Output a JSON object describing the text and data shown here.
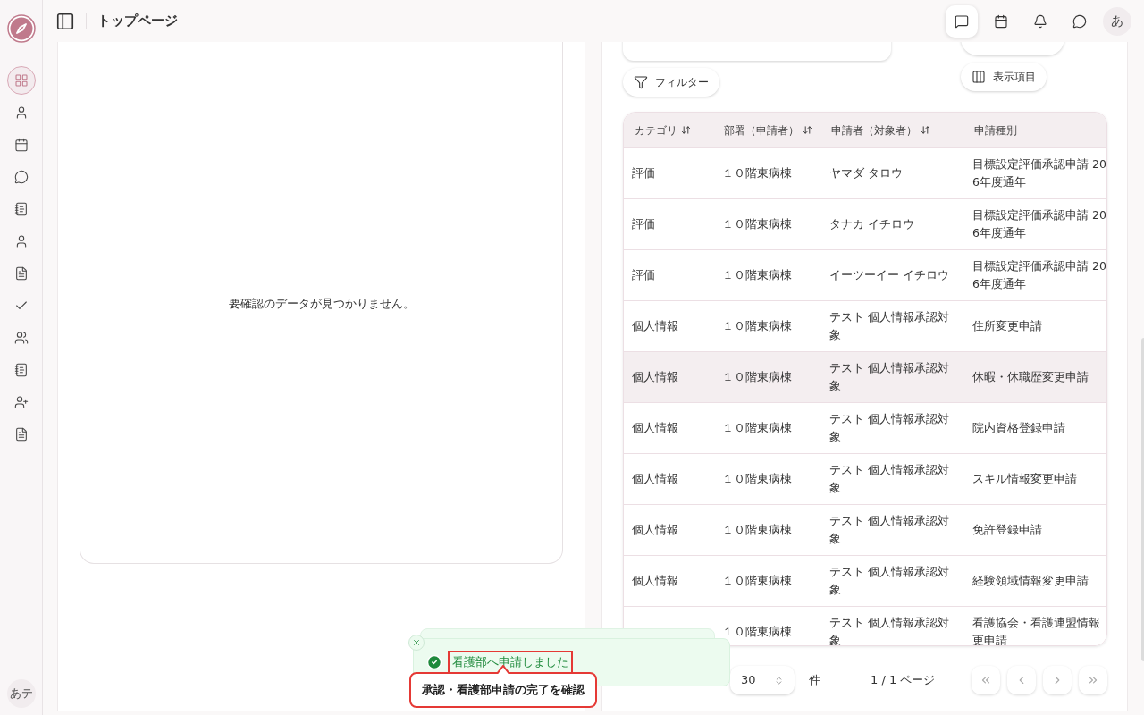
{
  "sidebar": {
    "items": [
      {
        "selected": true
      },
      {
        "selected": false
      },
      {
        "selected": false
      },
      {
        "selected": false
      },
      {
        "selected": false
      },
      {
        "selected": false
      },
      {
        "selected": false
      },
      {
        "selected": false
      },
      {
        "selected": false
      },
      {
        "selected": false
      },
      {
        "selected": false
      },
      {
        "selected": false
      }
    ],
    "avatar": "あテ"
  },
  "header": {
    "title": "トップページ",
    "icons": [
      {
        "selected": true
      },
      {
        "selected": false
      },
      {
        "selected": false
      },
      {
        "selected": false
      }
    ],
    "avatar": "あ"
  },
  "left_panel": {
    "empty_message": "要確認のデータが見つかりません。"
  },
  "right_panel": {
    "filter_button": "フィルター",
    "columns_button": "表示項目",
    "table": {
      "columns": [
        {
          "label": "カテゴリ",
          "sortable": true
        },
        {
          "label": "部署（申請者）",
          "sortable": true
        },
        {
          "label": "申請者（対象者）",
          "sortable": true
        },
        {
          "label": "申請種別",
          "sortable": false
        }
      ],
      "rows": [
        {
          "selected": false,
          "cells": [
            [
              "評価"
            ],
            [
              "１０階東病棟"
            ],
            [
              "ヤマダ タロウ"
            ],
            [
              "目標設定評価承認申請 20",
              "6年度通年"
            ]
          ]
        },
        {
          "selected": false,
          "cells": [
            [
              "評価"
            ],
            [
              "１０階東病棟"
            ],
            [
              "タナカ イチロウ"
            ],
            [
              "目標設定評価承認申請 20",
              "6年度通年"
            ]
          ]
        },
        {
          "selected": false,
          "cells": [
            [
              "評価"
            ],
            [
              "１０階東病棟"
            ],
            [
              "イーツーイー イチロウ"
            ],
            [
              "目標設定評価承認申請 20",
              "6年度通年"
            ]
          ]
        },
        {
          "selected": false,
          "cells": [
            [
              "個人情報"
            ],
            [
              "１０階東病棟"
            ],
            [
              "テスト 個人情報承認対",
              "象"
            ],
            [
              "住所変更申請"
            ]
          ]
        },
        {
          "selected": true,
          "cells": [
            [
              "個人情報"
            ],
            [
              "１０階東病棟"
            ],
            [
              "テスト 個人情報承認対",
              "象"
            ],
            [
              "休暇・休職歴変更申請"
            ]
          ]
        },
        {
          "selected": false,
          "cells": [
            [
              "個人情報"
            ],
            [
              "１０階東病棟"
            ],
            [
              "テスト 個人情報承認対",
              "象"
            ],
            [
              "院内資格登録申請"
            ]
          ]
        },
        {
          "selected": false,
          "cells": [
            [
              "個人情報"
            ],
            [
              "１０階東病棟"
            ],
            [
              "テスト 個人情報承認対",
              "象"
            ],
            [
              "スキル情報変更申請"
            ]
          ]
        },
        {
          "selected": false,
          "cells": [
            [
              "個人情報"
            ],
            [
              "１０階東病棟"
            ],
            [
              "テスト 個人情報承認対",
              "象"
            ],
            [
              "免許登録申請"
            ]
          ]
        },
        {
          "selected": false,
          "cells": [
            [
              "個人情報"
            ],
            [
              "１０階東病棟"
            ],
            [
              "テスト 個人情報承認対",
              "象"
            ],
            [
              "経験領域情報変更申請"
            ]
          ]
        },
        {
          "selected": false,
          "cells": [
            null,
            [
              "１０階東病棟"
            ],
            [
              "テスト 個人情報承認対",
              "象"
            ],
            [
              "看護協会・看護連盟情報",
              "更申請"
            ]
          ]
        }
      ]
    },
    "pagination": {
      "page_size": "30",
      "unit": "件",
      "page_info": "1 / 1 ページ"
    }
  },
  "toast": {
    "message": "看護部へ申請しました",
    "annotation": "承認・看護部申請の完了を確認"
  }
}
